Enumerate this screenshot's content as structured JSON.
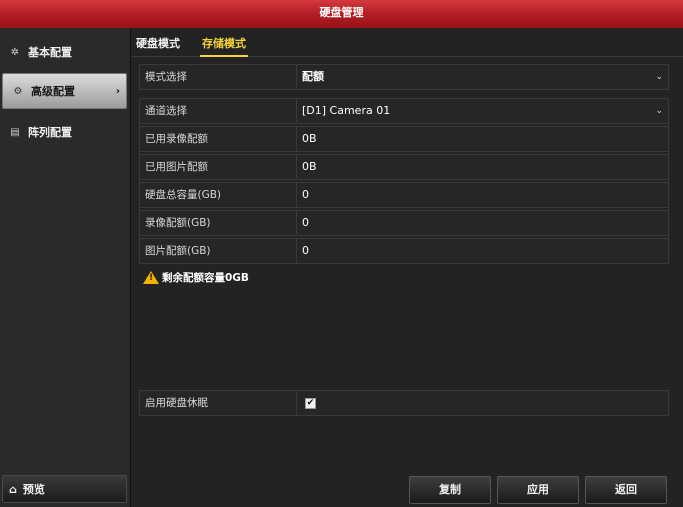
{
  "window": {
    "title": "硬盘管理"
  },
  "sidebar": {
    "items": [
      {
        "label": "基本配置",
        "icon": "gear-icon"
      },
      {
        "label": "高级配置",
        "icon": "advanced-settings-icon"
      },
      {
        "label": "阵列配置",
        "icon": "array-icon"
      }
    ],
    "preview_label": "预览"
  },
  "tabs": [
    {
      "label": "硬盘模式"
    },
    {
      "label": "存储模式",
      "active": true
    }
  ],
  "form": {
    "mode_select": {
      "label": "模式选择",
      "value": "配额"
    },
    "channel_select": {
      "label": "通道选择",
      "value": "[D1] Camera 01"
    },
    "used_record_quota": {
      "label": "已用录像配额",
      "value": "0B"
    },
    "used_picture_quota": {
      "label": "已用图片配额",
      "value": "0B"
    },
    "hdd_total_capacity": {
      "label": "硬盘总容量(GB)",
      "value": "0"
    },
    "record_quota": {
      "label": "录像配额(GB)",
      "value": "0"
    },
    "picture_quota": {
      "label": "图片配额(GB)",
      "value": "0"
    },
    "remaining_warning": "剩余配额容量0GB",
    "hdd_sleep": {
      "label": "启用硬盘休眠",
      "checked": true
    }
  },
  "buttons": {
    "copy": "复制",
    "apply": "应用",
    "back": "返回"
  },
  "colors": {
    "title_red": "#b01b22",
    "tab_active": "#f4d23a",
    "warning": "#f2b400"
  }
}
